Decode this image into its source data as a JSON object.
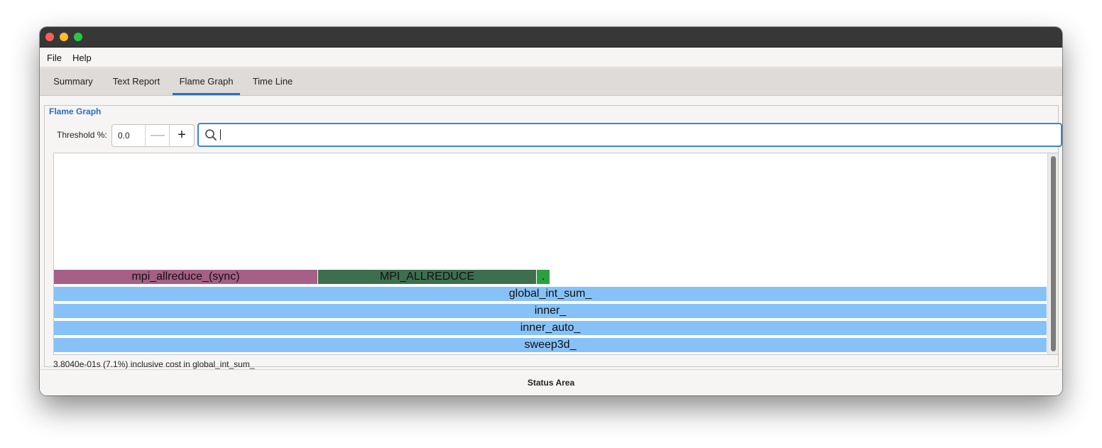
{
  "menubar": {
    "items": [
      "File",
      "Help"
    ]
  },
  "tabs": [
    {
      "label": "Summary",
      "active": false
    },
    {
      "label": "Text Report",
      "active": false
    },
    {
      "label": "Flame Graph",
      "active": true
    },
    {
      "label": "Time Line",
      "active": false
    }
  ],
  "flame_graph": {
    "group_title": "Flame Graph",
    "threshold_label": "Threshold %:",
    "threshold_value": "0.0",
    "search_value": "",
    "frames": [
      {
        "label": "mpi_allreduce_(sync)",
        "depth": 4,
        "start_fraction": 0.0,
        "width_fraction": 0.266,
        "color": "#a65f86"
      },
      {
        "label": "MPI_ALLREDUCE",
        "depth": 4,
        "start_fraction": 0.266,
        "width_fraction": 0.22,
        "color": "#3d6f4f"
      },
      {
        "label": ".",
        "depth": 4,
        "start_fraction": 0.486,
        "width_fraction": 0.0135,
        "color": "#2aa03f"
      },
      {
        "label": "global_int_sum_",
        "depth": 3,
        "start_fraction": 0.0,
        "width_fraction": 1.0,
        "color": "#86c2f7"
      },
      {
        "label": "inner_",
        "depth": 2,
        "start_fraction": 0.0,
        "width_fraction": 1.0,
        "color": "#86c2f7"
      },
      {
        "label": "inner_auto_",
        "depth": 1,
        "start_fraction": 0.0,
        "width_fraction": 1.0,
        "color": "#86c2f7"
      },
      {
        "label": "sweep3d_",
        "depth": 0,
        "start_fraction": 0.0,
        "width_fraction": 1.0,
        "color": "#86c2f7"
      }
    ],
    "cost_text": "3.8040e-01s (7.1%) inclusive cost in global_int_sum_"
  },
  "status_area": "Status Area",
  "icons": {
    "search": "search-icon",
    "minus": "minus-icon",
    "plus": "plus-icon"
  }
}
